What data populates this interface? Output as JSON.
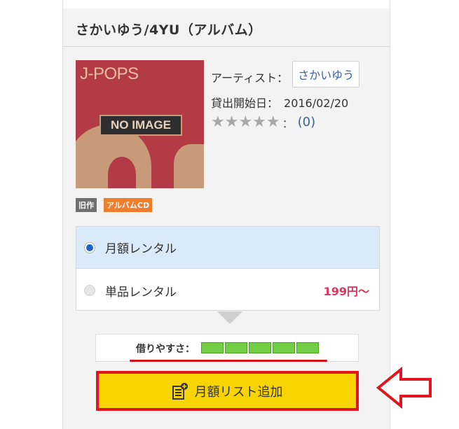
{
  "title": "さかいゆう/4YU（アルバム）",
  "jacket": {
    "label": "J-POPS",
    "no_image": "NO IMAGE"
  },
  "meta": {
    "artist_label": "アーティスト：",
    "artist_value": "さかいゆう",
    "date_label": "貸出開始日：",
    "date_value": "2016/02/20",
    "rating_stars": "★★★★★",
    "rating_colon": "：",
    "rating_count": "(0)"
  },
  "badges": {
    "old": "旧作",
    "album_cd": "アルバムCD"
  },
  "options": {
    "monthly_label": "月額レンタル",
    "single_label": "単品レンタル",
    "single_price": "199円〜",
    "selected": "monthly"
  },
  "ease": {
    "label": "借りやすさ：",
    "level": 5,
    "max": 5
  },
  "add_button": {
    "label": "月額リスト追加"
  },
  "colors": {
    "selected_bg": "#dbeaf8",
    "price": "#d9375b",
    "button": "#f8d500",
    "highlight": "#e0151f",
    "ease_bar": "#72cc44"
  },
  "icons": [
    "radio-selected-icon",
    "radio-unselected-icon",
    "star-icon",
    "list-add-icon",
    "left-arrow-icon"
  ]
}
